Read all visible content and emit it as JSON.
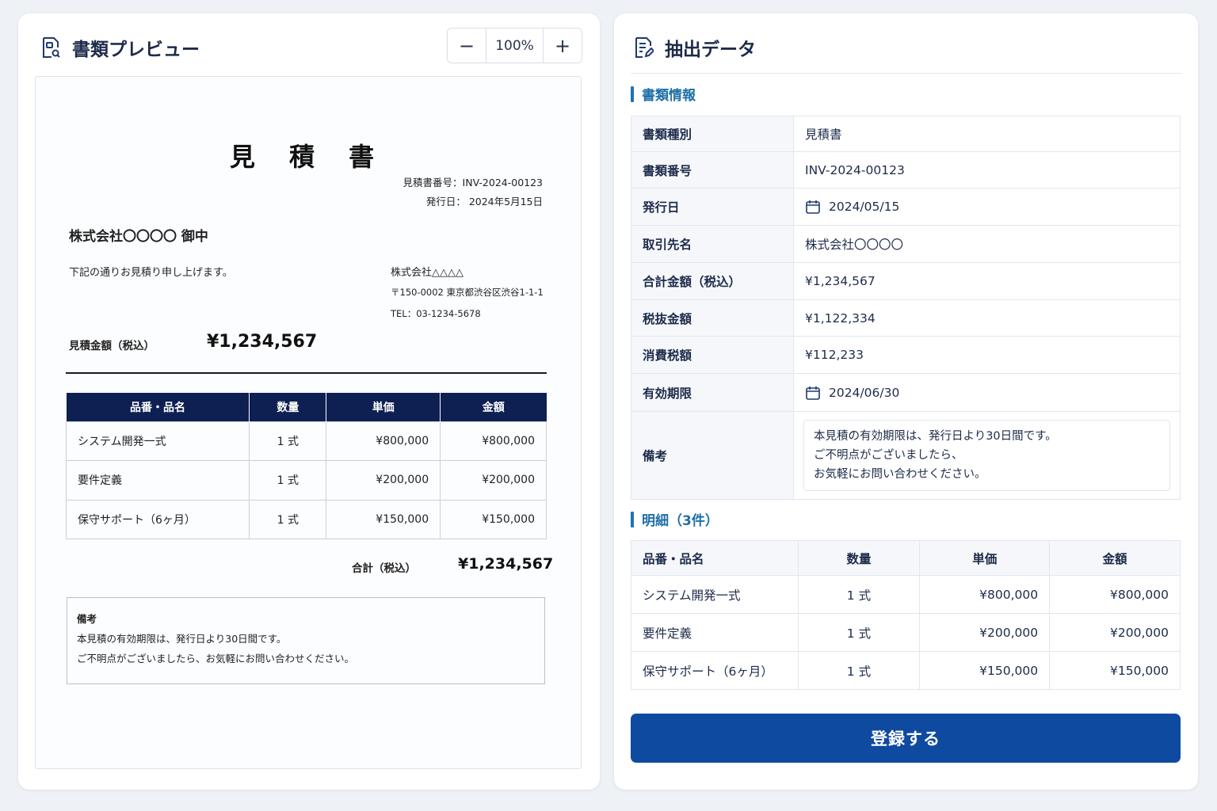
{
  "preview": {
    "title": "書類プレビュー",
    "zoom": {
      "minus": "−",
      "value": "100%",
      "plus": "+"
    },
    "document": {
      "title": "見 積 書",
      "number_line": "見積書番号：INV-2024-00123",
      "date_line": "発行日： 2024年5月15日",
      "recipient": "株式会社〇〇〇〇 御中",
      "greeting": "下記の通りお見積り申し上げます。",
      "issuer_name": "株式会社△△△△",
      "issuer_address": "〒150-0002 東京都渋谷区渋谷1-1-1",
      "issuer_tel": "TEL：03-1234-5678",
      "amount_label": "見積金額（税込）",
      "amount_value": "¥1,234,567",
      "table_headers": [
        "品番・品名",
        "数量",
        "単価",
        "金額"
      ],
      "rows": [
        {
          "name": "システム開発一式",
          "qty": "1 式",
          "unit": "¥800,000",
          "amount": "¥800,000"
        },
        {
          "name": "要件定義",
          "qty": "1 式",
          "unit": "¥200,000",
          "amount": "¥200,000"
        },
        {
          "name": "保守サポート（6ヶ月）",
          "qty": "1 式",
          "unit": "¥150,000",
          "amount": "¥150,000"
        }
      ],
      "total_label": "合計（税込）",
      "total_value": "¥1,234,567",
      "notes_title": "備考",
      "notes_line1": "本見積の有効期限は、発行日より30日間です。",
      "notes_line2": "ご不明点がございましたら、お気軽にお問い合わせください。"
    }
  },
  "extracted": {
    "title": "抽出データ",
    "info_section": "書類情報",
    "fields": {
      "doc_type": {
        "label": "書類種別",
        "value": "見積書"
      },
      "doc_number": {
        "label": "書類番号",
        "value": "INV-2024-00123"
      },
      "issue_date": {
        "label": "発行日",
        "value": "2024/05/15"
      },
      "client": {
        "label": "取引先名",
        "value": "株式会社〇〇〇〇"
      },
      "total": {
        "label": "合計金額（税込）",
        "value": "¥1,234,567"
      },
      "subtotal": {
        "label": "税抜金額",
        "value": "¥1,122,334"
      },
      "tax": {
        "label": "消費税額",
        "value": "¥112,233"
      },
      "expiry": {
        "label": "有効期限",
        "value": "2024/06/30"
      },
      "remarks": {
        "label": "備考",
        "line1": "本見積の有効期限は、発行日より30日間です。",
        "line2": "ご不明点がございましたら、",
        "line3": "お気軽にお問い合わせください。"
      }
    },
    "items_section": "明細（3件）",
    "item_headers": [
      "品番・品名",
      "数量",
      "単価",
      "金額"
    ],
    "items": [
      {
        "name": "システム開発一式",
        "qty": "1 式",
        "unit": "¥800,000",
        "amount": "¥800,000"
      },
      {
        "name": "要件定義",
        "qty": "1 式",
        "unit": "¥200,000",
        "amount": "¥200,000"
      },
      {
        "name": "保守サポート（6ヶ月）",
        "qty": "1 式",
        "unit": "¥150,000",
        "amount": "¥150,000"
      }
    ],
    "register_label": "登録する"
  },
  "colors": {
    "primary": "#0f4aa1",
    "accent": "#1e73b8",
    "header_navy": "#0e1f52"
  },
  "icons": {
    "preview": "document-search-icon",
    "extract": "document-edit-icon",
    "date": "calendar-icon"
  }
}
